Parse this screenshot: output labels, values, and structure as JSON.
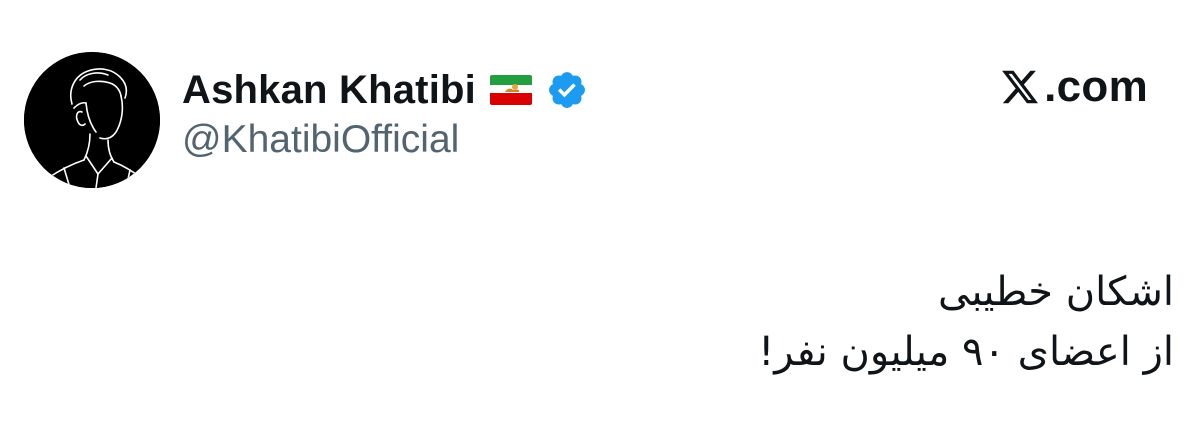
{
  "author": {
    "display_name": "Ashkan Khatibi",
    "handle": "@KhatibiOfficial",
    "flag_icon": "iran-lion-and-sun-flag-icon",
    "verified_icon": "verified-badge-icon",
    "verified_color": "#1d9bf0"
  },
  "brand": {
    "logo_icon": "x-logo-icon",
    "domain": ".com"
  },
  "tweet": {
    "lines": [
      "اشکان خطیبی",
      "از اعضای ۹۰ میلیون نفر!"
    ]
  },
  "colors": {
    "text": "#0f1419",
    "secondary_text": "#536471",
    "background": "#ffffff",
    "avatar_background": "#000000"
  }
}
